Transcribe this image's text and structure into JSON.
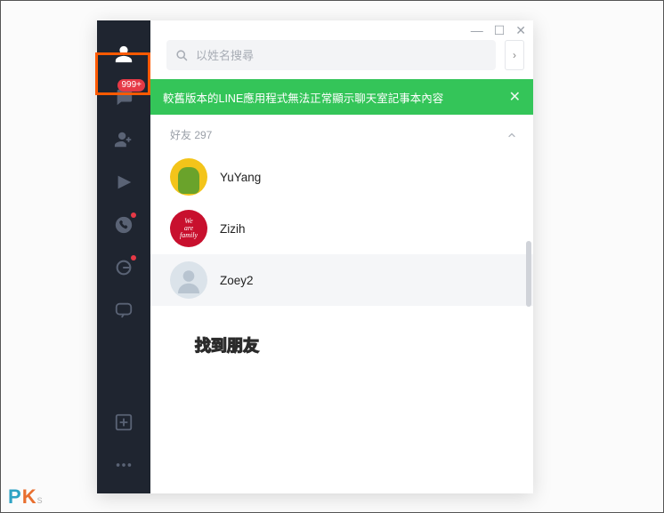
{
  "sidebar": {
    "items": [
      {
        "name": "friends-icon",
        "active": true
      },
      {
        "name": "chats-icon",
        "badge": "999+"
      },
      {
        "name": "add-friend-icon"
      },
      {
        "name": "voom-icon"
      },
      {
        "name": "calls-icon",
        "dot": true
      },
      {
        "name": "open-chat-icon",
        "dot": true
      },
      {
        "name": "line-logo-icon"
      }
    ],
    "bottom_items": [
      {
        "name": "add-screen-icon"
      },
      {
        "name": "more-icon"
      }
    ]
  },
  "window_controls": {
    "minimize": "—",
    "maximize": "☐",
    "close": "✕"
  },
  "search": {
    "placeholder": "以姓名搜尋"
  },
  "notice": {
    "text": "較舊版本的LINE應用程式無法正常顯示聊天室記事本內容",
    "close": "✕"
  },
  "section": {
    "label": "好友 297"
  },
  "friends": [
    {
      "name": "YuYang"
    },
    {
      "name": "Zizih"
    },
    {
      "name": "Zoey2"
    }
  ],
  "annotation": {
    "label": "找到朋友"
  },
  "watermark": {
    "p": "P",
    "k": "K",
    "tail": "s"
  }
}
